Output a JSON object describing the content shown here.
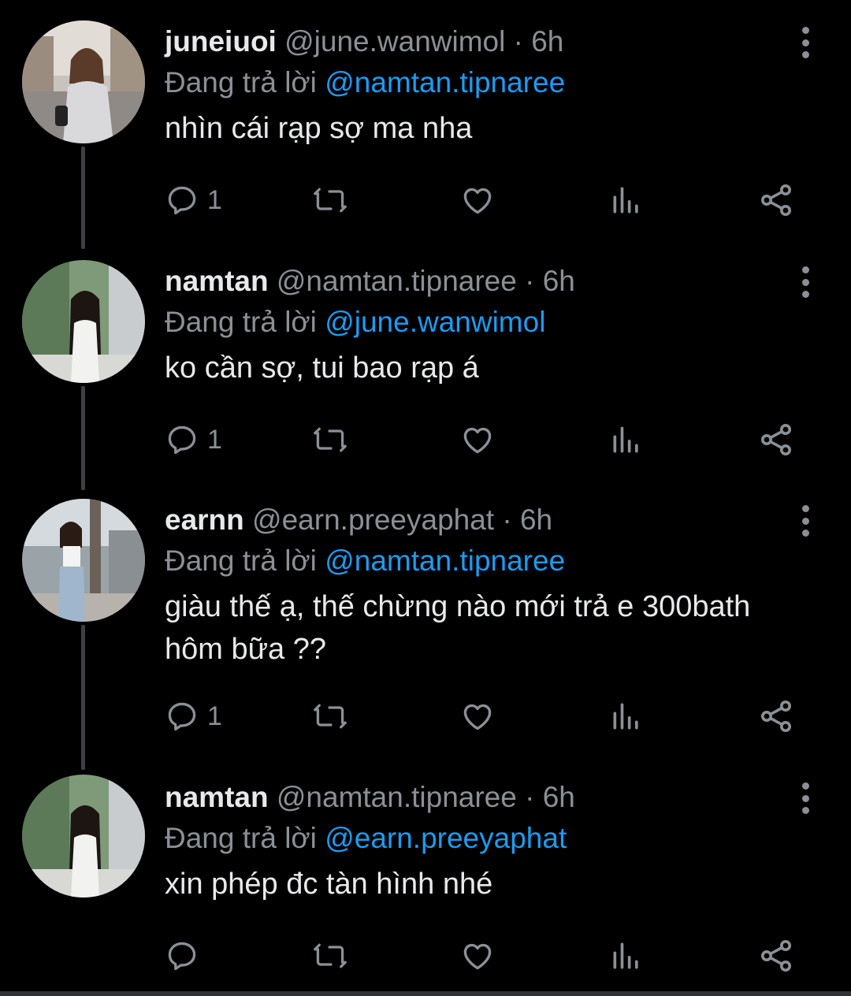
{
  "colors": {
    "background": "#000000",
    "mention": "#1d9bf0",
    "muted": "#8b9096",
    "text": "#e7e9ea"
  },
  "reply_prefix": "Đang trả lời",
  "tweets": [
    {
      "name": "juneiuoi",
      "handle": "@june.wanwimol",
      "separator": "·",
      "time": "6h",
      "reply_to": "@namtan.tipnaree",
      "text": "nhìn cái rạp sợ ma nha",
      "reply_count": "1",
      "icons": [
        "reply-icon",
        "retweet-icon",
        "like-icon",
        "views-icon",
        "share-icon",
        "more-icon"
      ]
    },
    {
      "name": "namtan",
      "handle": "@namtan.tipnaree",
      "separator": "·",
      "time": "6h",
      "reply_to": "@june.wanwimol",
      "text": "ko cần sợ, tui bao rạp á",
      "reply_count": "1",
      "icons": [
        "reply-icon",
        "retweet-icon",
        "like-icon",
        "views-icon",
        "share-icon",
        "more-icon"
      ]
    },
    {
      "name": "earnn",
      "handle": "@earn.preeyaphat",
      "separator": "·",
      "time": "6h",
      "reply_to": "@namtan.tipnaree",
      "text_line1": "giàu thế ạ, thế chừng nào mới trả e 300bath",
      "text_line2": "hôm bữa ??",
      "reply_count": "1",
      "icons": [
        "reply-icon",
        "retweet-icon",
        "like-icon",
        "views-icon",
        "share-icon",
        "more-icon"
      ]
    },
    {
      "name": "namtan",
      "handle": "@namtan.tipnaree",
      "separator": "·",
      "time": "6h",
      "reply_to": "@earn.preeyaphat",
      "text": "xin phép đc tàn hình nhé",
      "reply_count": "",
      "icons": [
        "reply-icon",
        "retweet-icon",
        "like-icon",
        "views-icon",
        "share-icon",
        "more-icon"
      ]
    }
  ]
}
